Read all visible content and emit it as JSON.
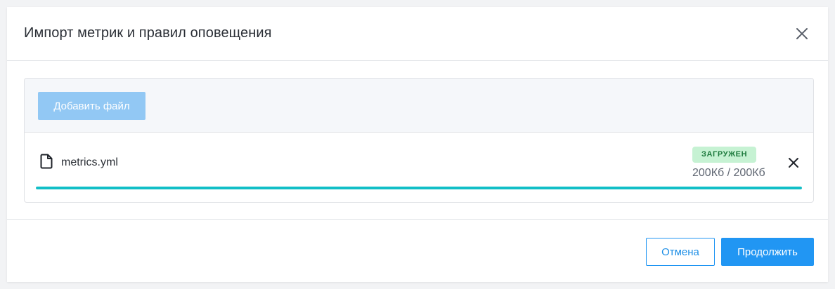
{
  "dialog": {
    "title": "Импорт метрик и правил оповещения"
  },
  "toolbar": {
    "add_file_label": "Добавить файл"
  },
  "file": {
    "name": "metrics.yml",
    "status": "ЗАГРУЖЕН",
    "size": "200Кб / 200Кб",
    "progress": 1.0,
    "icon": "file-icon"
  },
  "footer": {
    "cancel_label": "Отмена",
    "continue_label": "Продолжить"
  },
  "colors": {
    "primary": "#2196f3",
    "primary_disabled": "#92c8f4",
    "progress": "#12bfc7",
    "status_bg": "#c6f2d3",
    "status_text": "#1d7a3d"
  }
}
